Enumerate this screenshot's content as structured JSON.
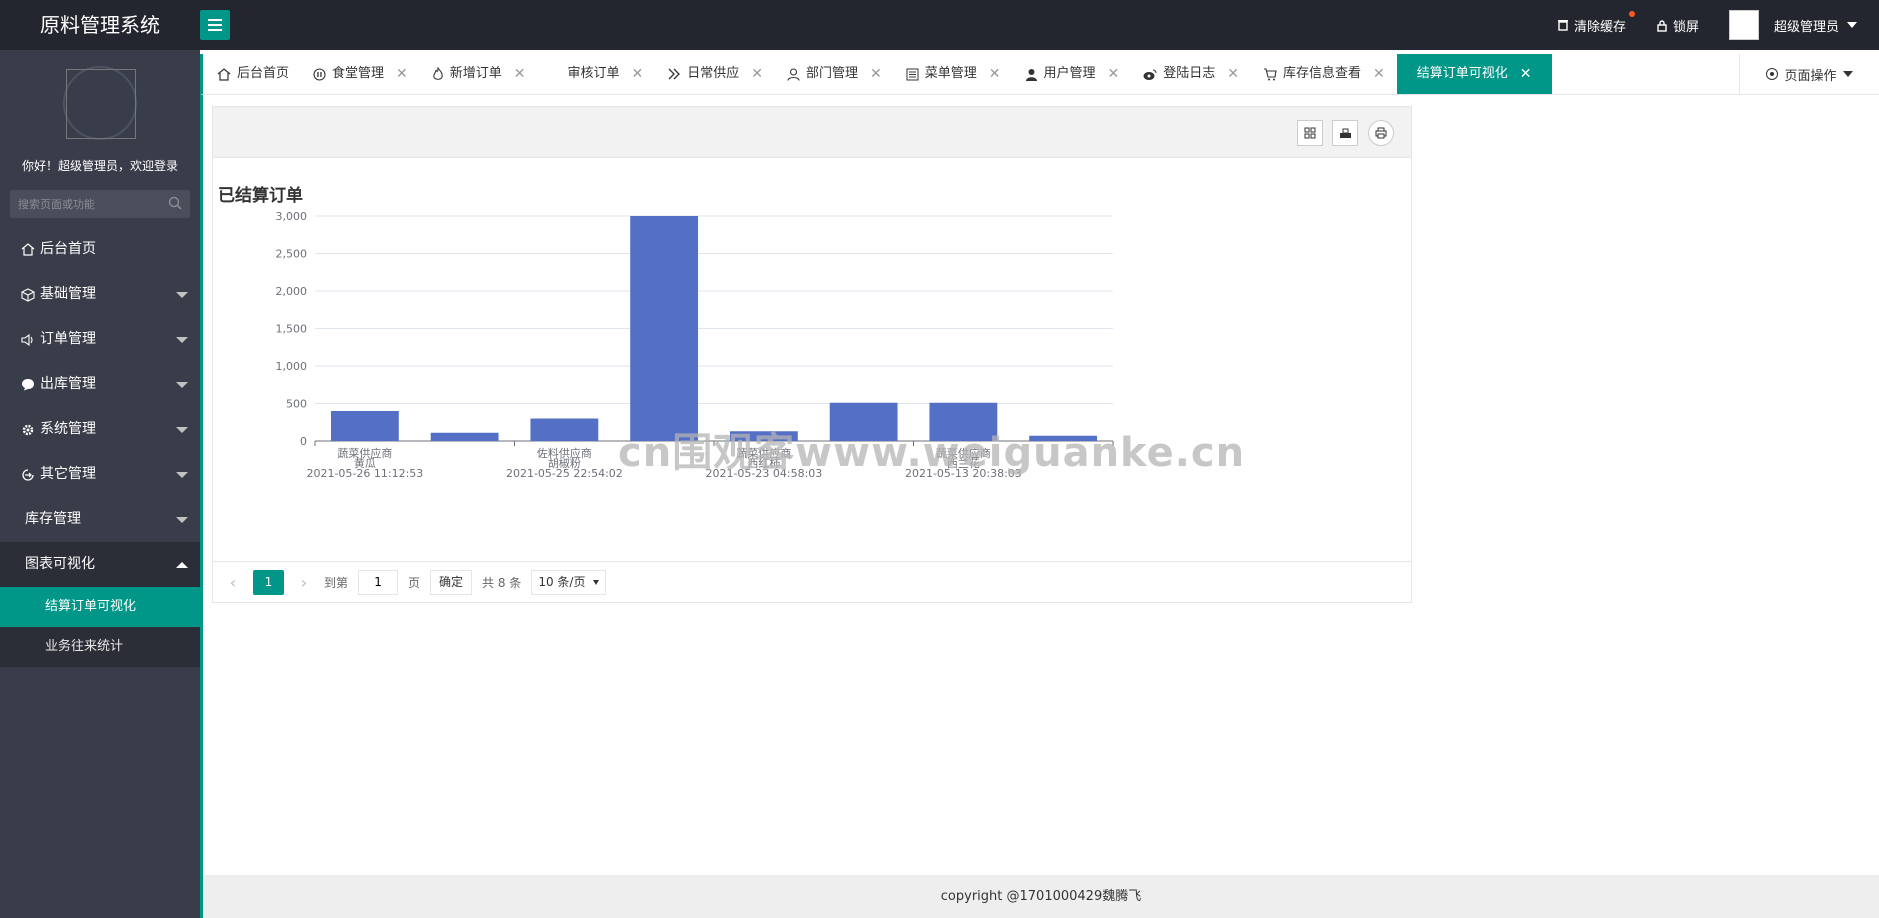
{
  "app": {
    "title": "原料管理系统"
  },
  "topbar": {
    "clear_cache": "清除缓存",
    "lock_screen": "锁屏",
    "user_name": "超级管理员"
  },
  "sidebar": {
    "welcome": "你好！超级管理员，欢迎登录",
    "search_placeholder": "搜索页面或功能",
    "items": [
      {
        "label": "后台首页",
        "icon": "home-icon"
      },
      {
        "label": "基础管理",
        "icon": "cube-icon"
      },
      {
        "label": "订单管理",
        "icon": "volume-icon"
      },
      {
        "label": "出库管理",
        "icon": "chat-icon"
      },
      {
        "label": "系统管理",
        "icon": "gear-icon"
      },
      {
        "label": "其它管理",
        "icon": "circle-arrow-icon"
      },
      {
        "label": "库存管理",
        "icon": ""
      },
      {
        "label": "图表可视化",
        "icon": ""
      }
    ],
    "sub_items": [
      {
        "label": "结算订单可视化"
      },
      {
        "label": "业务往来统计"
      }
    ]
  },
  "tabs": [
    {
      "label": "后台首页",
      "icon": "home-icon"
    },
    {
      "label": "食堂管理",
      "icon": "pause-icon"
    },
    {
      "label": "新增订单",
      "icon": "fire-icon"
    },
    {
      "label": "审核订单",
      "icon": ""
    },
    {
      "label": "日常供应",
      "icon": "double-chevron-icon"
    },
    {
      "label": "部门管理",
      "icon": "user-outline-icon"
    },
    {
      "label": "菜单管理",
      "icon": "menu-doc-icon"
    },
    {
      "label": "用户管理",
      "icon": "user-icon"
    },
    {
      "label": "登陆日志",
      "icon": "weibo-icon"
    },
    {
      "label": "库存信息查看",
      "icon": "cart-icon"
    },
    {
      "label": "结算订单可视化",
      "icon": ""
    }
  ],
  "page_ops": "页面操作",
  "panel": {
    "title": "已结算订单"
  },
  "chart_data": {
    "type": "bar",
    "title": "",
    "categories": [
      "",
      "",
      "",
      "",
      "",
      "",
      "",
      ""
    ],
    "tick_labels": [
      {
        "supplier": "蔬菜供应商",
        "item": "黄瓜",
        "date": "2021-05-26 11:12:53"
      },
      {
        "supplier": "佐料供应商",
        "item": "胡椒粉",
        "date": "2021-05-25 22:54:02"
      },
      {
        "supplier": "蔬菜供应商",
        "item": "西红柿",
        "date": "2021-05-23 04:58:03"
      },
      {
        "supplier": "蔬菜供应商",
        "item": "西兰花",
        "date": "2021-05-13 20:38:03"
      }
    ],
    "values": [
      400,
      110,
      300,
      3000,
      130,
      510,
      510,
      70
    ],
    "y_ticks": [
      "0",
      "500",
      "1,000",
      "1,500",
      "2,000",
      "2,500",
      "3,000"
    ],
    "ylim": [
      0,
      3000
    ],
    "bar_color": "#5470c6",
    "grid": true
  },
  "watermark": "cn围观客www.weiguanke.cn",
  "pager": {
    "current": "1",
    "goto_label": "到第",
    "page_value": "1",
    "page_unit": "页",
    "confirm": "确定",
    "total": "共 8 条",
    "page_size": "10 条/页"
  },
  "footer": "copyright @1701000429魏腾飞",
  "colors": {
    "accent": "#009688",
    "topbar": "#23262e",
    "sidebar": "#393d49"
  }
}
